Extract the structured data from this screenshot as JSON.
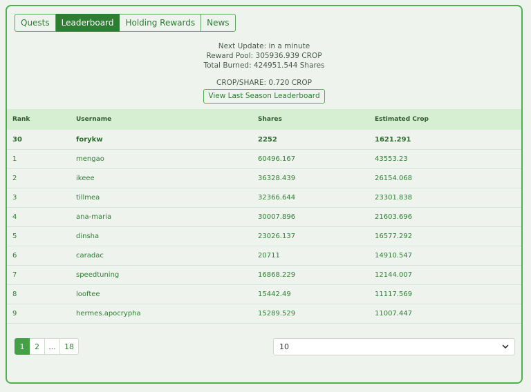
{
  "tabs": [
    "Quests",
    "Leaderboard",
    "Holding Rewards",
    "News"
  ],
  "info": {
    "next_update": "Next Update: in a minute",
    "reward_pool": "Reward Pool: 305936.939 CROP",
    "total_burned": "Total Burned: 424951.544 Shares",
    "crop_per_share": "CROP/SHARE: 0.720 CROP",
    "last_season_button": "View Last Season Leaderboard"
  },
  "table": {
    "headers": [
      "Rank",
      "Username",
      "Shares",
      "Estimated Crop"
    ],
    "current_user": [
      "30",
      "forykw",
      "2252",
      "1621.291"
    ],
    "rows": [
      [
        "1",
        "mengao",
        "60496.167",
        "43553.23"
      ],
      [
        "2",
        "ikeee",
        "36328.439",
        "26154.068"
      ],
      [
        "3",
        "tillmea",
        "32366.644",
        "23301.838"
      ],
      [
        "4",
        "ana-maria",
        "30007.896",
        "21603.696"
      ],
      [
        "5",
        "dinsha",
        "23026.137",
        "16577.292"
      ],
      [
        "6",
        "caradac",
        "20711",
        "14910.547"
      ],
      [
        "7",
        "speedtuning",
        "16868.229",
        "12144.007"
      ],
      [
        "8",
        "looftee",
        "15442.49",
        "11117.569"
      ],
      [
        "9",
        "hermes.apocrypha",
        "15289.529",
        "11007.447"
      ]
    ]
  },
  "pagination": [
    "1",
    "2",
    "...",
    "18"
  ],
  "page_size": {
    "selected": "10"
  },
  "icons": {
    "select_arrow": "chevron-down-icon"
  }
}
